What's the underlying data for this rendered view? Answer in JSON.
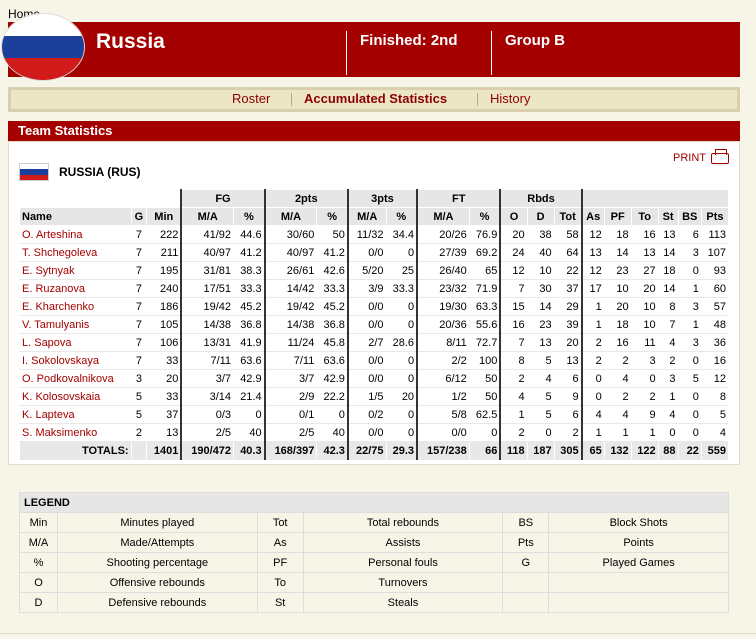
{
  "nav": {
    "home": "Home"
  },
  "header": {
    "country": "Russia",
    "finished": "Finished: 2nd",
    "group": "Group B"
  },
  "tabs": [
    {
      "label": "Roster",
      "active": false
    },
    {
      "label": "Accumulated Statistics",
      "active": true
    },
    {
      "label": "History",
      "active": false
    }
  ],
  "panel": {
    "title": "Team Statistics",
    "print": "PRINT",
    "team_label": "RUSSIA (RUS)"
  },
  "table": {
    "group_headers": {
      "fg": "FG",
      "p2": "2pts",
      "p3": "3pts",
      "ft": "FT",
      "rbds": "Rbds"
    },
    "columns": [
      "Name",
      "G",
      "Min",
      "M/A",
      "%",
      "M/A",
      "%",
      "M/A",
      "%",
      "M/A",
      "%",
      "O",
      "D",
      "Tot",
      "As",
      "PF",
      "To",
      "St",
      "BS",
      "Pts"
    ],
    "rows": [
      [
        "O. Arteshina",
        "7",
        "222",
        "41/92",
        "44.6",
        "30/60",
        "50",
        "11/32",
        "34.4",
        "20/26",
        "76.9",
        "20",
        "38",
        "58",
        "12",
        "18",
        "16",
        "13",
        "6",
        "113"
      ],
      [
        "T. Shchegoleva",
        "7",
        "211",
        "40/97",
        "41.2",
        "40/97",
        "41.2",
        "0/0",
        "0",
        "27/39",
        "69.2",
        "24",
        "40",
        "64",
        "13",
        "14",
        "13",
        "14",
        "3",
        "107"
      ],
      [
        "E. Sytnyak",
        "7",
        "195",
        "31/81",
        "38.3",
        "26/61",
        "42.6",
        "5/20",
        "25",
        "26/40",
        "65",
        "12",
        "10",
        "22",
        "12",
        "23",
        "27",
        "18",
        "0",
        "93"
      ],
      [
        "E. Ruzanova",
        "7",
        "240",
        "17/51",
        "33.3",
        "14/42",
        "33.3",
        "3/9",
        "33.3",
        "23/32",
        "71.9",
        "7",
        "30",
        "37",
        "17",
        "10",
        "20",
        "14",
        "1",
        "60"
      ],
      [
        "E. Kharchenko",
        "7",
        "186",
        "19/42",
        "45.2",
        "19/42",
        "45.2",
        "0/0",
        "0",
        "19/30",
        "63.3",
        "15",
        "14",
        "29",
        "1",
        "20",
        "10",
        "8",
        "3",
        "57"
      ],
      [
        "V. Tamulyanis",
        "7",
        "105",
        "14/38",
        "36.8",
        "14/38",
        "36.8",
        "0/0",
        "0",
        "20/36",
        "55.6",
        "16",
        "23",
        "39",
        "1",
        "18",
        "10",
        "7",
        "1",
        "48"
      ],
      [
        "L. Sapova",
        "7",
        "106",
        "13/31",
        "41.9",
        "11/24",
        "45.8",
        "2/7",
        "28.6",
        "8/11",
        "72.7",
        "7",
        "13",
        "20",
        "2",
        "16",
        "11",
        "4",
        "3",
        "36"
      ],
      [
        "I. Sokolovskaya",
        "7",
        "33",
        "7/11",
        "63.6",
        "7/11",
        "63.6",
        "0/0",
        "0",
        "2/2",
        "100",
        "8",
        "5",
        "13",
        "2",
        "2",
        "3",
        "2",
        "0",
        "16"
      ],
      [
        "O. Podkovalnikova",
        "3",
        "20",
        "3/7",
        "42.9",
        "3/7",
        "42.9",
        "0/0",
        "0",
        "6/12",
        "50",
        "2",
        "4",
        "6",
        "0",
        "4",
        "0",
        "3",
        "5",
        "12"
      ],
      [
        "K. Kolosovskaia",
        "5",
        "33",
        "3/14",
        "21.4",
        "2/9",
        "22.2",
        "1/5",
        "20",
        "1/2",
        "50",
        "4",
        "5",
        "9",
        "0",
        "2",
        "2",
        "1",
        "0",
        "8"
      ],
      [
        "K. Lapteva",
        "5",
        "37",
        "0/3",
        "0",
        "0/1",
        "0",
        "0/2",
        "0",
        "5/8",
        "62.5",
        "1",
        "5",
        "6",
        "4",
        "4",
        "9",
        "4",
        "0",
        "5"
      ],
      [
        "S. Maksimenko",
        "2",
        "13",
        "2/5",
        "40",
        "2/5",
        "40",
        "0/0",
        "0",
        "0/0",
        "0",
        "2",
        "0",
        "2",
        "1",
        "1",
        "1",
        "0",
        "0",
        "4"
      ]
    ],
    "totals": [
      "TOTALS:",
      "",
      "1401",
      "190/472",
      "40.3",
      "168/397",
      "42.3",
      "22/75",
      "29.3",
      "157/238",
      "66",
      "118",
      "187",
      "305",
      "65",
      "132",
      "122",
      "88",
      "22",
      "559"
    ]
  },
  "legend": {
    "title": "LEGEND",
    "rows": [
      [
        "Min",
        "Minutes played",
        "Tot",
        "Total rebounds",
        "BS",
        "Block Shots"
      ],
      [
        "M/A",
        "Made/Attempts",
        "As",
        "Assists",
        "Pts",
        "Points"
      ],
      [
        "%",
        "Shooting percentage",
        "PF",
        "Personal fouls",
        "G",
        "Played Games"
      ],
      [
        "O",
        "Offensive rebounds",
        "To",
        "Turnovers",
        "",
        ""
      ],
      [
        "D",
        "Defensive rebounds",
        "St",
        "Steals",
        "",
        ""
      ]
    ]
  },
  "colors": {
    "brand": "#a40000",
    "flag_white": "#ffffff",
    "flag_blue": "#1c3f9c",
    "flag_red": "#d11a1a"
  }
}
